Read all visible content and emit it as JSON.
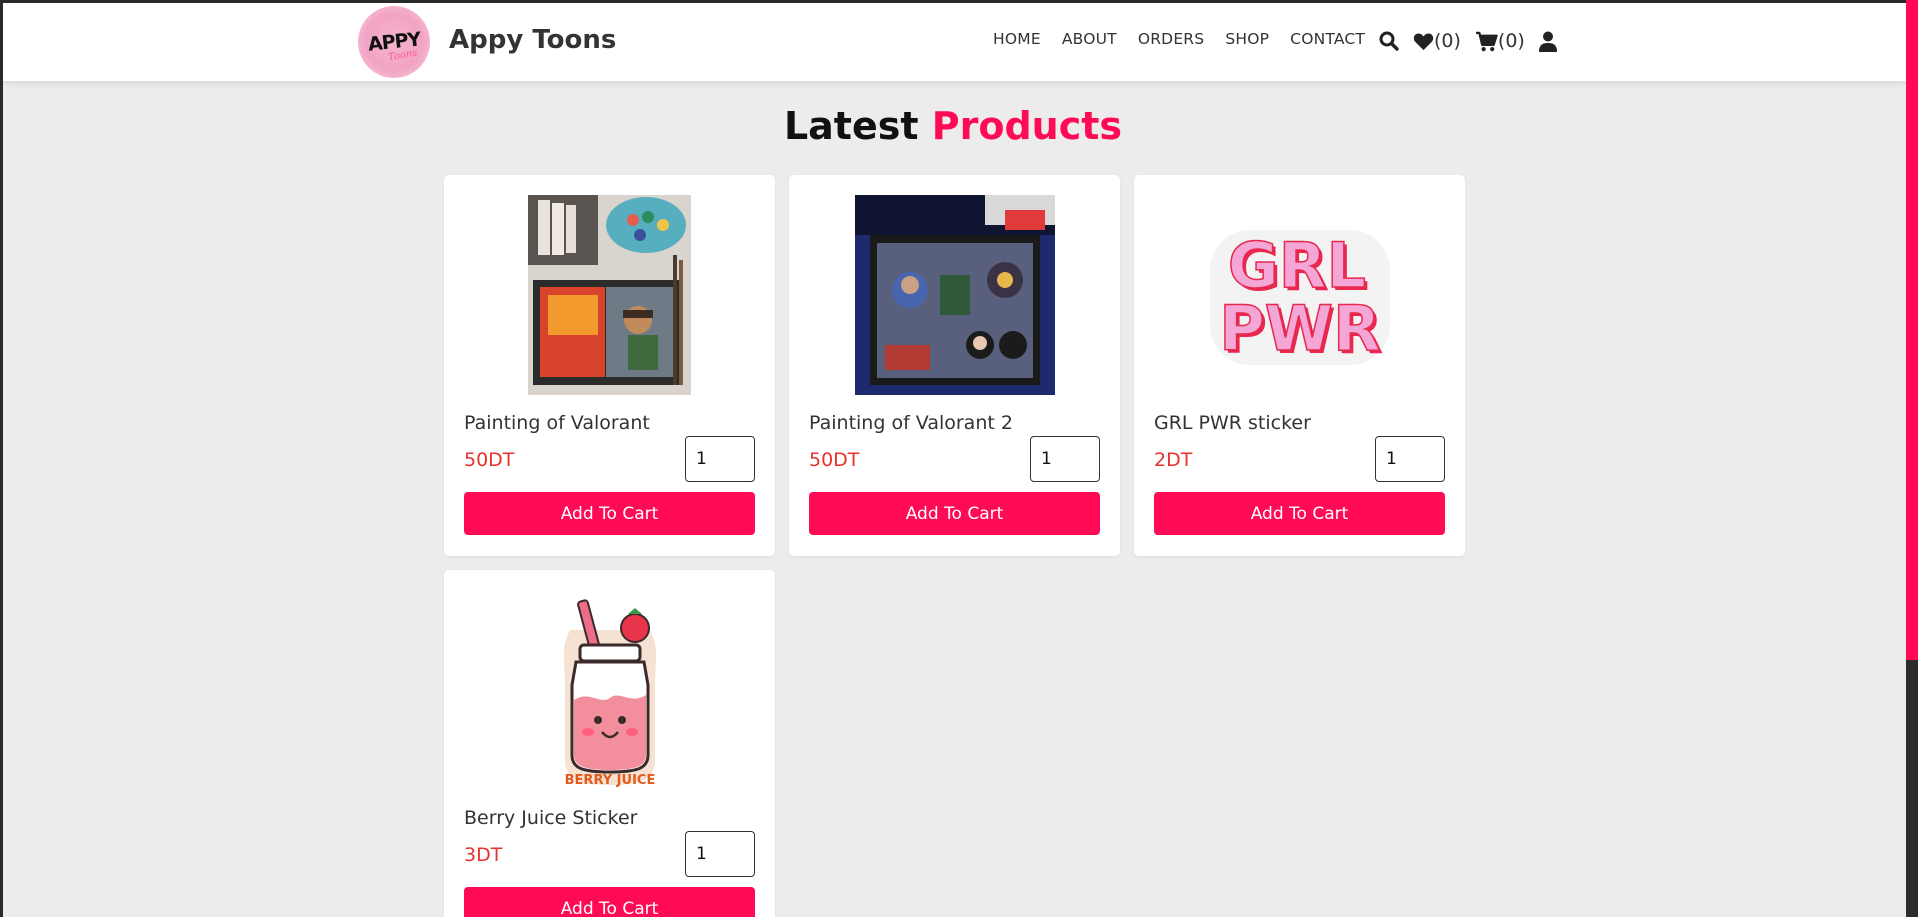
{
  "brand": {
    "name": "Appy Toons",
    "logo_text": "APPY",
    "logo_sub": "Toons"
  },
  "nav": {
    "items": [
      "HOME",
      "ABOUT",
      "ORDERS",
      "SHOP",
      "CONTACT"
    ]
  },
  "header_icons": {
    "search": "search-icon",
    "wishlist": {
      "icon": "heart-icon",
      "count": "(0)"
    },
    "cart": {
      "icon": "cart-icon",
      "count": "(0)"
    },
    "user": "user-icon"
  },
  "section": {
    "title_part1": "Latest",
    "title_part2": "Products"
  },
  "colors": {
    "accent": "#ff0a54",
    "price": "#e8322d",
    "background": "#ececec"
  },
  "products": [
    {
      "name": "Painting of Valorant",
      "price": "50DT",
      "qty": "1",
      "button": "Add To Cart"
    },
    {
      "name": "Painting of Valorant 2",
      "price": "50DT",
      "qty": "1",
      "button": "Add To Cart"
    },
    {
      "name": "GRL PWR sticker",
      "price": "2DT",
      "qty": "1",
      "button": "Add To Cart",
      "image_text": [
        "GRL",
        "PWR"
      ]
    },
    {
      "name": "Berry Juice Sticker",
      "price": "3DT",
      "qty": "1",
      "button": "Add To Cart",
      "image_text": "BERRY JUICE"
    }
  ]
}
